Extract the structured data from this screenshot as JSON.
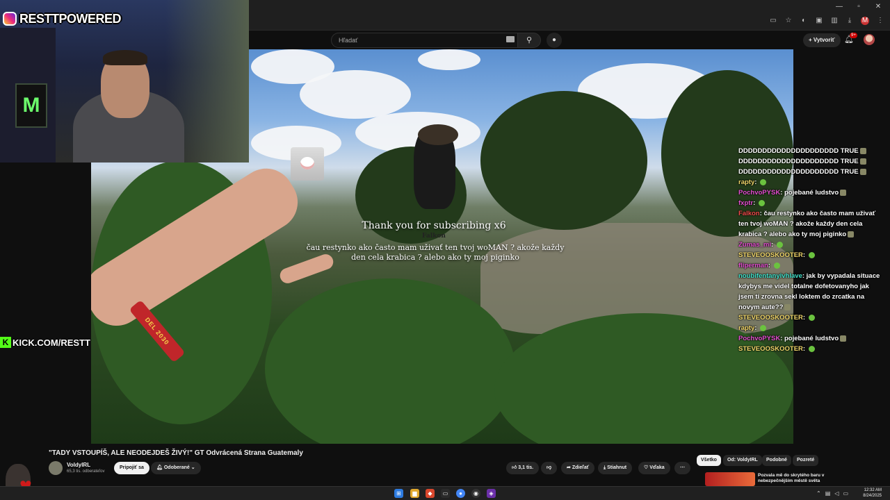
{
  "browser": {
    "search_placeholder": "Hľadať",
    "create_label": "Vytvoriť",
    "notif_count": "9+"
  },
  "overlay": {
    "instagram_handle": "RESTTPOWERED",
    "kick_handle": "KICK.COM/RESTT",
    "wristband_text": "DEL 2030"
  },
  "alert": {
    "title": "Thank you for subscribing x6",
    "name": "Falkon",
    "message": "čau restynko ako často mam uživať ten tvoj woMAN ? akože každy den cela krabica ? alebo ako ty moj piginko"
  },
  "chat": [
    {
      "user": "",
      "text": "DDDDDDDDDDDDDDDDDDDDD TRUE",
      "color": ""
    },
    {
      "user": "",
      "text": "DDDDDDDDDDDDDDDDDDDDD TRUE",
      "color": ""
    },
    {
      "user": "",
      "text": "DDDDDDDDDDDDDDDDDDDDD TRUE",
      "color": ""
    },
    {
      "user": "rapty",
      "text": "",
      "color": "gold"
    },
    {
      "user": "PochvoPYSK",
      "text": "pojebané ludstvo",
      "color": ""
    },
    {
      "user": "fxptr",
      "text": "",
      "color": ""
    },
    {
      "user": "Falkon",
      "text": "čau restynko ako často mam uživať ten tvoj woMAN ? akože každy den cela krabica ? alebo ako ty moj piginko",
      "color": "red"
    },
    {
      "user": "Zumas_mi",
      "text": "",
      "color": ""
    },
    {
      "user": "STEVEOOSKOOTER",
      "text": "",
      "color": "gold"
    },
    {
      "user": "fliperman",
      "text": "",
      "color": ""
    },
    {
      "user": "noubifentanyivhlave",
      "text": "jak by vypadala situace kdybys me videl totalne dofetovanyho jak jsem ti zrovna sekl loktem do zrcatka na novym aute??",
      "color": "teal"
    },
    {
      "user": "STEVEOOSKOOTER",
      "text": "",
      "color": "gold"
    },
    {
      "user": "rapty",
      "text": "",
      "color": "gold"
    },
    {
      "user": "PochvoPYSK",
      "text": "pojebané ludstvo",
      "color": ""
    },
    {
      "user": "STEVEOOSKOOTER",
      "text": "",
      "color": "gold"
    }
  ],
  "video": {
    "title": "\"TADY VSTOUPÍŠ, ALE NEODEJDEŠ ŽIVÝ!\" GT Odvrácená Strana Guatemaly",
    "channel_name": "VoldyIRL",
    "channel_subs": "65,3 tis. odberateľov",
    "join_label": "Pripojiť sa",
    "subscribed_label": "Odoberané",
    "like_count": "3,1 tis.",
    "share_label": "Zdieľať",
    "download_label": "Stiahnut",
    "thanks_label": "Vďaka"
  },
  "sidebar": {
    "chips": [
      "Všetko",
      "Od: VoldyIRL",
      "Podobné",
      "Pozreté"
    ],
    "rec_title": "Pozvala mě do skrytého baru v nebezpečnějším městě světa"
  },
  "taskbar": {
    "time": "12:32 AM",
    "date": "8/24/2025"
  },
  "colors": {
    "kick_green": "#53fc18",
    "youtube_bg": "#0f0f0f",
    "chat_user_pink": "#e44fd0"
  }
}
